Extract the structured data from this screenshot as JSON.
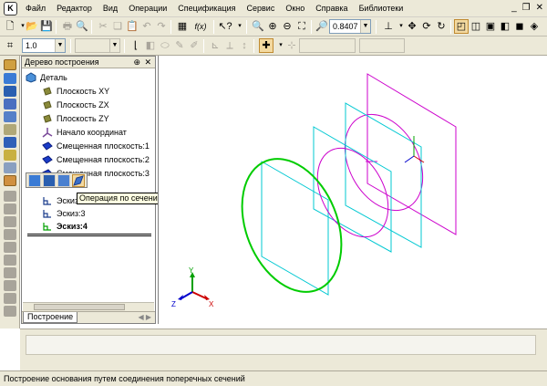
{
  "menu": [
    "Файл",
    "Редактор",
    "Вид",
    "Операции",
    "Спецификация",
    "Сервис",
    "Окно",
    "Справка",
    "Библиотеки"
  ],
  "toolbar": {
    "zoom_value": "0.8407",
    "step_value": "1.0"
  },
  "tree": {
    "title": "Дерево построения",
    "items": [
      {
        "label": "Деталь",
        "icon": "part-icon"
      },
      {
        "label": "Плоскость XY",
        "icon": "plane-icon"
      },
      {
        "label": "Плоскость ZX",
        "icon": "plane-icon"
      },
      {
        "label": "Плоскость ZY",
        "icon": "plane-icon"
      },
      {
        "label": "Начало координат",
        "icon": "origin-icon"
      },
      {
        "label": "Смещенная плоскость:1",
        "icon": "offset-plane-icon"
      },
      {
        "label": "Смещенная плоскость:2",
        "icon": "offset-plane-icon"
      },
      {
        "label": "Смещенная плоскость:3",
        "icon": "offset-plane-icon"
      },
      {
        "label": "Эскиз:",
        "icon": "sketch-icon"
      },
      {
        "label": "Эскиз:3",
        "icon": "sketch-icon"
      },
      {
        "label": "Эскиз:4",
        "icon": "sketch-icon"
      }
    ],
    "tab": "Построение"
  },
  "tooltip": "Операция по сечениям",
  "axes": {
    "x": "X",
    "y": "Y",
    "z": "Z"
  },
  "status": "Построение основания путем соединения поперечных сечений",
  "colors": {
    "ui": "#ece9d8",
    "green_sketch": "#00cc00",
    "cyan_plane": "#00c8d2",
    "magenta_plane": "#cc00cc",
    "highlight": "#f3d9a0"
  }
}
